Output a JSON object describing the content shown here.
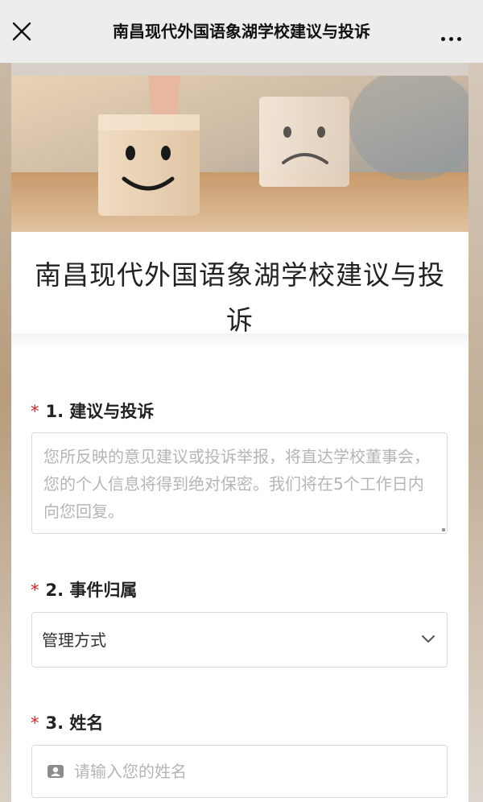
{
  "navbar": {
    "title": "南昌现代外国语象湖学校建议与投诉",
    "close_icon": "close-icon",
    "more_icon": "more-dots-icon"
  },
  "banner": {
    "description_icons": [
      "smiley-block",
      "sad-block"
    ]
  },
  "form": {
    "title": "南昌现代外国语象湖学校建议与投诉",
    "questions": [
      {
        "required_mark": "*",
        "label": "1. 建议与投诉",
        "placeholder": "您所反映的意见建议或投诉举报，将直达学校董事会，您的个人信息将得到绝对保密。我们将在5个工作日内向您回复。"
      },
      {
        "required_mark": "*",
        "label": "2. 事件归属",
        "selected_value": "管理方式",
        "icon": "chevron-down-icon"
      },
      {
        "required_mark": "*",
        "label": "3. 姓名",
        "placeholder": "请输入您的姓名",
        "icon": "person-card-icon"
      }
    ]
  },
  "colors": {
    "required": "#e02020",
    "placeholder": "#b5b5b5",
    "border": "#d9d9d9",
    "navbar_bg": "#ededed"
  }
}
